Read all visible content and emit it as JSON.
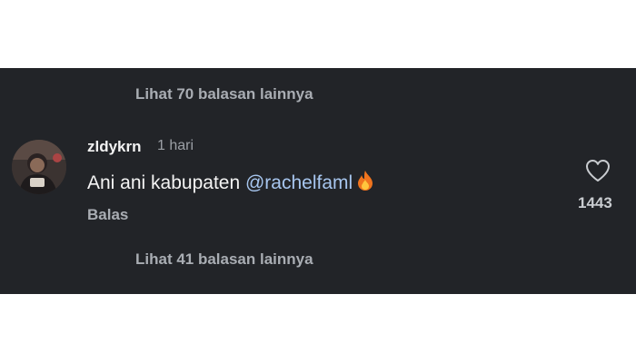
{
  "thread": {
    "view_more_top": "Lihat 70 balasan lainnya",
    "view_more_bottom": "Lihat 41 balasan lainnya"
  },
  "comment": {
    "username": "zldykrn",
    "time": "1 hari",
    "text": "Ani ani kabupaten ",
    "mention": "@rachelfaml",
    "emoji_icon": "fire-icon",
    "reply_label": "Balas",
    "like_count": "1443",
    "like_icon": "heart-outline-icon"
  },
  "colors": {
    "background": "#222428",
    "mention": "#a7c6ef",
    "muted_text": "#a9adb3"
  }
}
